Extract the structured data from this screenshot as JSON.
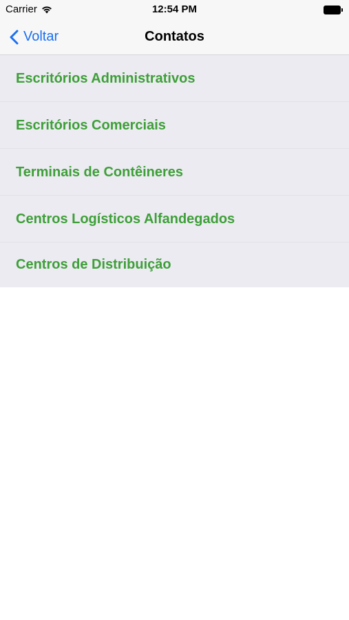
{
  "status_bar": {
    "carrier": "Carrier",
    "time": "12:54 PM",
    "wifi_icon": "wifi-icon",
    "battery_icon": "battery-icon"
  },
  "nav": {
    "back_label": "Voltar",
    "back_icon": "chevron-left-icon",
    "title": "Contatos",
    "accent_color": "#1a6ff0"
  },
  "list": {
    "text_color": "#3e9f38",
    "background": "#ebebf1",
    "items": [
      {
        "label": "Escritórios Administrativos"
      },
      {
        "label": "Escritórios Comerciais"
      },
      {
        "label": "Terminais de Contêineres"
      },
      {
        "label": "Centros Logísticos Alfandegados"
      },
      {
        "label": "Centros de Distribuição"
      }
    ]
  }
}
